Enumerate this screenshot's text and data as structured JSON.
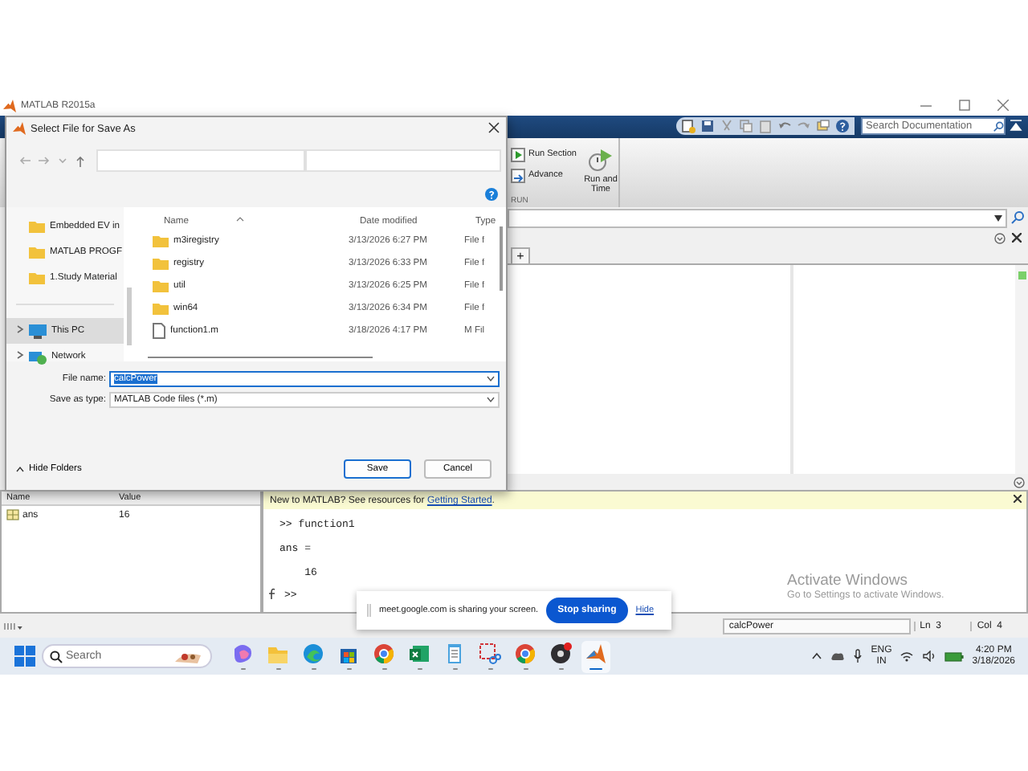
{
  "matlab_window": {
    "title": "MATLAB R2015a",
    "search": {
      "placeholder": "Search Documentation"
    },
    "ribbon": {
      "buttons": [
        {
          "label": "Run Section",
          "kind": "run-section"
        },
        {
          "label": "Advance",
          "kind": "advance"
        },
        {
          "label": "Run and Time",
          "kind": "run-time"
        }
      ],
      "group": "RUN"
    },
    "editor_tabs": [
      "+"
    ],
    "workspace": {
      "columns": [
        "Name",
        "Value"
      ],
      "rows": [
        {
          "name": "ans",
          "value": "16"
        }
      ]
    },
    "command_window": {
      "banner": {
        "text": "New to MATLAB? See resources for ",
        "link": "Getting Started",
        "end": "."
      },
      "lines": [
        ">> function1",
        "ans =",
        "    16"
      ],
      "prompt": ">>"
    },
    "status_bar": {
      "file": "calcPower",
      "line": "Ln  3",
      "column": "Col  4"
    }
  },
  "dialog": {
    "title": "Select File for Save As",
    "nav_pane": [
      {
        "label": "Embedded EV in",
        "kind": "folder",
        "selected": false
      },
      {
        "label": "MATLAB PROGF",
        "kind": "folder",
        "selected": false
      },
      {
        "label": "1.Study Material",
        "kind": "folder",
        "selected": false
      },
      {
        "label": "This PC",
        "kind": "pc",
        "selected": true
      },
      {
        "label": "Network",
        "kind": "network",
        "selected": false
      }
    ],
    "columns": [
      "Name",
      "Date modified",
      "Type"
    ],
    "files": [
      {
        "name": "m3iregistry",
        "date": "3/13/2026 6:27 PM",
        "type": "File f",
        "kind": "folder"
      },
      {
        "name": "registry",
        "date": "3/13/2026 6:33 PM",
        "type": "File f",
        "kind": "folder"
      },
      {
        "name": "util",
        "date": "3/13/2026 6:25 PM",
        "type": "File f",
        "kind": "folder"
      },
      {
        "name": "win64",
        "date": "3/13/2026 6:34 PM",
        "type": "File f",
        "kind": "folder"
      },
      {
        "name": "function1.m",
        "date": "3/18/2026 4:17 PM",
        "type": "M Fil",
        "kind": "file"
      }
    ],
    "file_name": {
      "label": "File name:",
      "value": "calcPower"
    },
    "save_as_type": {
      "label": "Save as type:",
      "value": "MATLAB Code files (*.m)"
    },
    "hide_folders": "Hide Folders",
    "buttons": [
      "Save",
      "Cancel"
    ]
  },
  "screen_share": {
    "message": "meet.google.com is sharing your screen.",
    "stop": "Stop sharing",
    "hide": "Hide"
  },
  "activation": {
    "title": "Activate Windows",
    "subtitle": "Go to Settings to activate Windows."
  },
  "taskbar": {
    "search": {
      "placeholder": "Search"
    },
    "apps": [
      {
        "kind": "copilot",
        "selected": false
      },
      {
        "kind": "explorer",
        "selected": false
      },
      {
        "kind": "edge",
        "selected": false
      },
      {
        "kind": "store",
        "selected": false
      },
      {
        "kind": "chrome",
        "selected": false
      },
      {
        "kind": "excel",
        "selected": false
      },
      {
        "kind": "notepad",
        "selected": false
      },
      {
        "kind": "snip",
        "selected": false
      },
      {
        "kind": "chrome",
        "selected": false
      },
      {
        "kind": "obs",
        "selected": false
      },
      {
        "kind": "matlab",
        "selected": true
      }
    ],
    "language": "ENG",
    "region": "IN",
    "time": "4:20 PM",
    "date": "3/18/2026"
  }
}
